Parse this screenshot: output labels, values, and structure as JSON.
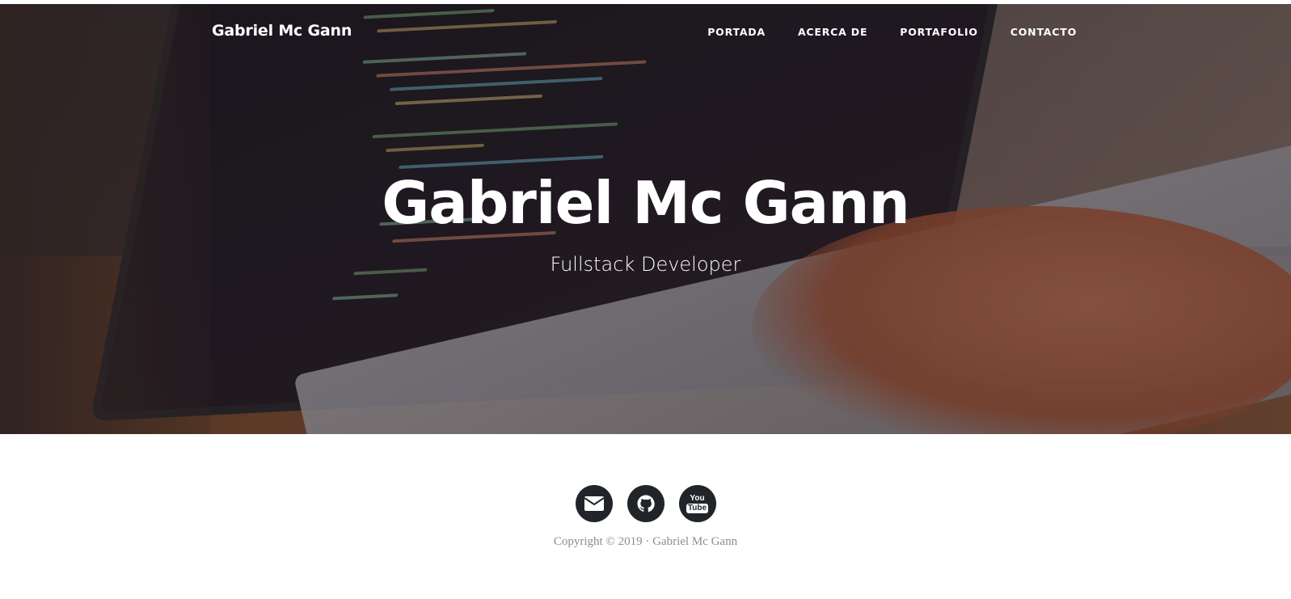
{
  "navbar": {
    "brand": "Gabriel Mc Gann",
    "links": [
      "PORTADA",
      "ACERCA DE",
      "PORTAFOLIO",
      "CONTACTO"
    ]
  },
  "hero": {
    "title": "Gabriel Mc Gann",
    "subtitle": "Fullstack Developer"
  },
  "footer": {
    "social_icons": [
      "envelope-icon",
      "github-icon",
      "youtube-icon"
    ],
    "copyright": "Copyright © 2019 · Gabriel Mc Gann"
  },
  "colors": {
    "overlay": "#16121a",
    "social_bg": "#212529",
    "copyright_text": "#868e96"
  }
}
